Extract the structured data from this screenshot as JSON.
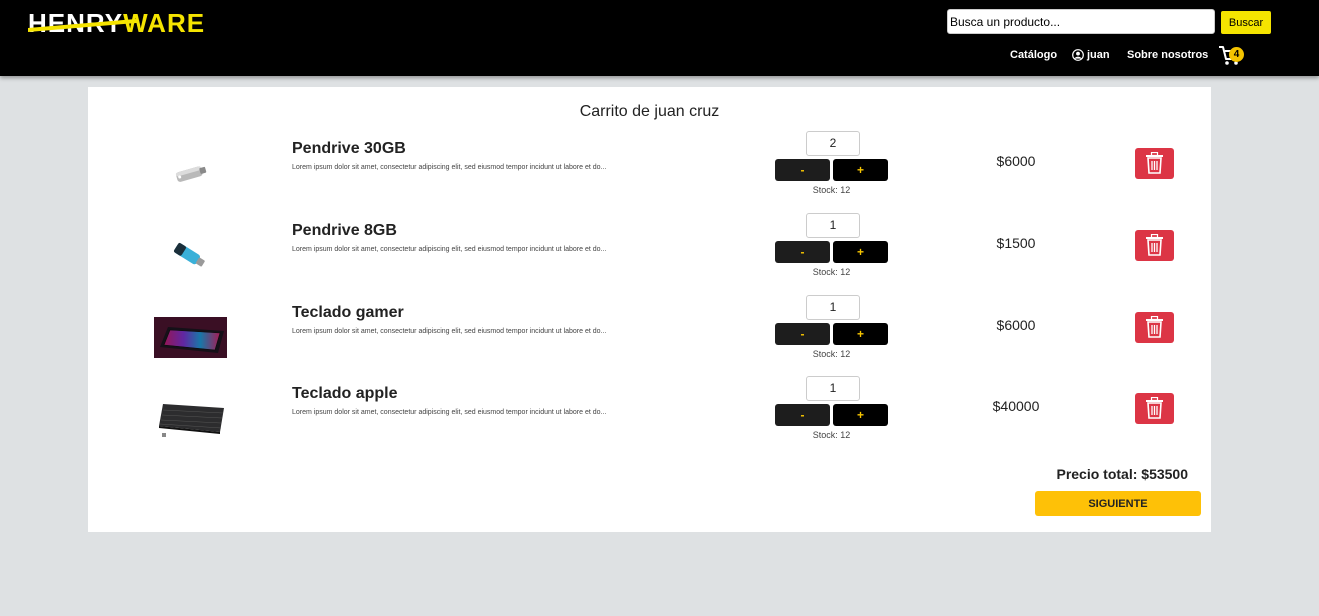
{
  "brand": {
    "logo_part1": "HENRY",
    "logo_part2": "WARE"
  },
  "search": {
    "placeholder": "Busca un producto...",
    "button_label": "Buscar"
  },
  "nav": {
    "catalog": "Catálogo",
    "user": "juan",
    "about": "Sobre nosotros",
    "cart_count": "4"
  },
  "cart": {
    "title": "Carrito de juan cruz",
    "items": [
      {
        "name": "Pendrive 30GB",
        "description": "Lorem ipsum dolor sit amet, consectetur adipiscing elit, sed eiusmod tempor incidunt ut labore et do...",
        "quantity": "2",
        "minus_label": "-",
        "plus_label": "+",
        "stock": "Stock: 12",
        "price": "$6000"
      },
      {
        "name": "Pendrive 8GB",
        "description": "Lorem ipsum dolor sit amet, consectetur adipiscing elit, sed eiusmod tempor incidunt ut labore et do...",
        "quantity": "1",
        "minus_label": "-",
        "plus_label": "+",
        "stock": "Stock: 12",
        "price": "$1500"
      },
      {
        "name": "Teclado gamer",
        "description": "Lorem ipsum dolor sit amet, consectetur adipiscing elit, sed eiusmod tempor incidunt ut labore et do...",
        "quantity": "1",
        "minus_label": "-",
        "plus_label": "+",
        "stock": "Stock: 12",
        "price": "$6000"
      },
      {
        "name": "Teclado apple",
        "description": "Lorem ipsum dolor sit amet, consectetur adipiscing elit, sed eiusmod tempor incidunt ut labore et do...",
        "quantity": "1",
        "minus_label": "-",
        "plus_label": "+",
        "stock": "Stock: 12",
        "price": "$40000"
      }
    ],
    "total": "Precio total: $53500",
    "next_label": "SIGUIENTE"
  },
  "colors": {
    "navbar": "#000000",
    "accent_yellow": "#f5e400",
    "next_button": "#fec107",
    "delete_button": "#dc3545",
    "page_bg": "#dee1e3"
  },
  "icons": {
    "cart": "cart-icon",
    "user": "user-circle-icon",
    "delete": "trash-icon"
  }
}
